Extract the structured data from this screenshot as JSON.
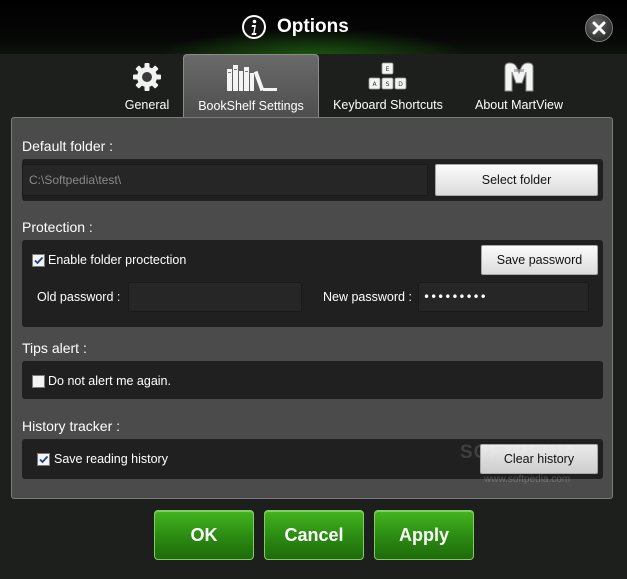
{
  "window": {
    "title": "Options"
  },
  "tabs": [
    {
      "label": "General",
      "icon": "gear-icon"
    },
    {
      "label": "BookShelf Settings",
      "icon": "bookshelf-icon"
    },
    {
      "label": "Keyboard Shortcuts",
      "icon": "keyboard-icon"
    },
    {
      "label": "About MartView",
      "icon": "martview-logo-icon"
    }
  ],
  "active_tab": "BookShelf Settings",
  "default_folder": {
    "label": "Default folder :",
    "path": "C:\\Softpedia\\test\\",
    "select_button": "Select folder"
  },
  "protection": {
    "label": "Protection :",
    "enable_label": "Enable folder proctection",
    "enable_checked": true,
    "save_button": "Save password",
    "old_password_label": "Old password :",
    "old_password_value": "",
    "new_password_label": "New password :",
    "new_password_masked": "•••••••••"
  },
  "tips": {
    "label": "Tips alert :",
    "checkbox_label": "Do not alert me again.",
    "checked": false
  },
  "history": {
    "label": "History tracker :",
    "checkbox_label": "Save reading history",
    "checked": true,
    "clear_button": "Clear history"
  },
  "watermark": {
    "text": "SOFTPEDIA",
    "sub": "www.softpedia.com"
  },
  "buttons": {
    "ok": "OK",
    "cancel": "Cancel",
    "apply": "Apply"
  },
  "colors": {
    "accent_green": "#2b8a12",
    "panel": "#4a4b4a",
    "box": "#1f201f"
  }
}
